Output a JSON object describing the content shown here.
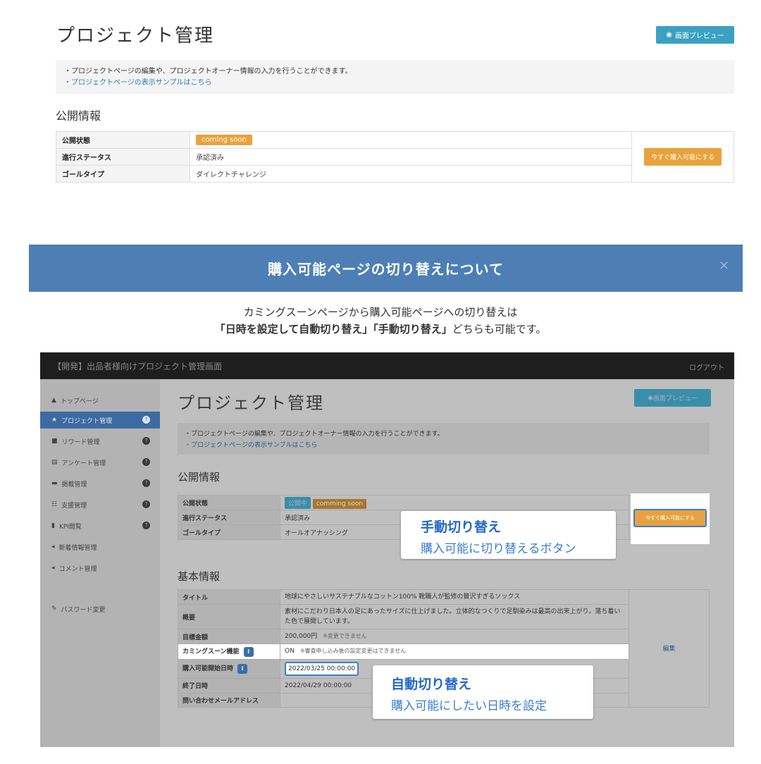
{
  "top": {
    "title": "プロジェクト管理",
    "preview_button": "画面プレビュー",
    "info_note": "・プロジェクトページの編集や、プロジェクトオーナー情報の入力を行うことができます。",
    "info_link": "・プロジェクトページの表示サンプルはこちら",
    "public_heading": "公開情報",
    "rows": [
      {
        "label": "公開状態",
        "value": "coming soon"
      },
      {
        "label": "進行ステータス",
        "value": "承認済み"
      },
      {
        "label": "ゴールタイプ",
        "value": "ダイレクトチャレンジ"
      }
    ],
    "buy_now_button": "今すぐ購入可能にする"
  },
  "banner": {
    "title": "購入可能ページの切り替えについて",
    "close": "×"
  },
  "description": {
    "line1": "カミングスーンページから購入可能ページへの切り替えは",
    "line2_a": "「日時を設定して自動切り替え」「手動切り替え」",
    "line2_b": "どちらも可能です。"
  },
  "screenshot": {
    "app_title": "【開発】出品者様向けプロジェクト管理画面",
    "logout": "ログアウト",
    "sidebar": [
      {
        "icon": "▲",
        "label": "トップページ"
      },
      {
        "icon": "★",
        "label": "プロジェクト管理"
      },
      {
        "icon": "■",
        "label": "リワード管理"
      },
      {
        "icon": "▤",
        "label": "アンケート管理"
      },
      {
        "icon": "▬",
        "label": "掲載管理"
      },
      {
        "icon": "☷",
        "label": "支援管理"
      },
      {
        "icon": "▮",
        "label": "KPI閲覧"
      },
      {
        "icon": "◂",
        "label": "新着情報管理"
      },
      {
        "icon": "◂",
        "label": "コメント管理"
      },
      {
        "icon": "✎",
        "label": "パスワード変更"
      }
    ],
    "title": "プロジェクト管理",
    "preview_button": "画面プレビュー",
    "info_note": "・プロジェクトページの編集や、プロジェクトオーナー情報の入力を行うことができます。",
    "info_link": "・プロジェクトページの表示サンプルはこちら",
    "public_heading": "公開情報",
    "public_rows": [
      {
        "label": "公開状態",
        "badge1": "公開中",
        "badge2": "comming soon"
      },
      {
        "label": "進行ステータス",
        "value": "承認済み"
      },
      {
        "label": "ゴールタイプ",
        "value": "オールオアナッシング"
      }
    ],
    "buy_now_button": "今すぐ購入可能にする",
    "basic_heading": "基本情報",
    "basic_rows": [
      {
        "label": "タイトル",
        "value": "地球にやさしいサステナブルなコットン100% 靴職人が監修の贅沢すぎるソックス"
      },
      {
        "label": "概要",
        "value": "素材にこだわり日本人の足にあったサイズに仕上げました。立体的なつくりで足馴染みは最高の出来上がり。落ち着いた色で展開しています。"
      },
      {
        "label": "目標金額",
        "value": "200,000円",
        "note": "※変更できません"
      },
      {
        "label": "カミングスーン機能",
        "value": "ON",
        "note": "※審査申し込み後の設定変更はできません"
      },
      {
        "label": "購入可能開始日時",
        "value": "2022/03/25 00:00:00"
      },
      {
        "label": "終了日時",
        "value": "2022/04/29 00:00:00"
      },
      {
        "label": "問い合わせメールアドレス",
        "value": ""
      }
    ],
    "edit_link": "編集",
    "info_icon_label": "i"
  },
  "callouts": {
    "manual_title": "手動切り替え",
    "manual_sub": "購入可能に切り替えるボタン",
    "auto_title": "自動切り替え",
    "auto_sub": "購入可能にしたい日時を設定"
  }
}
